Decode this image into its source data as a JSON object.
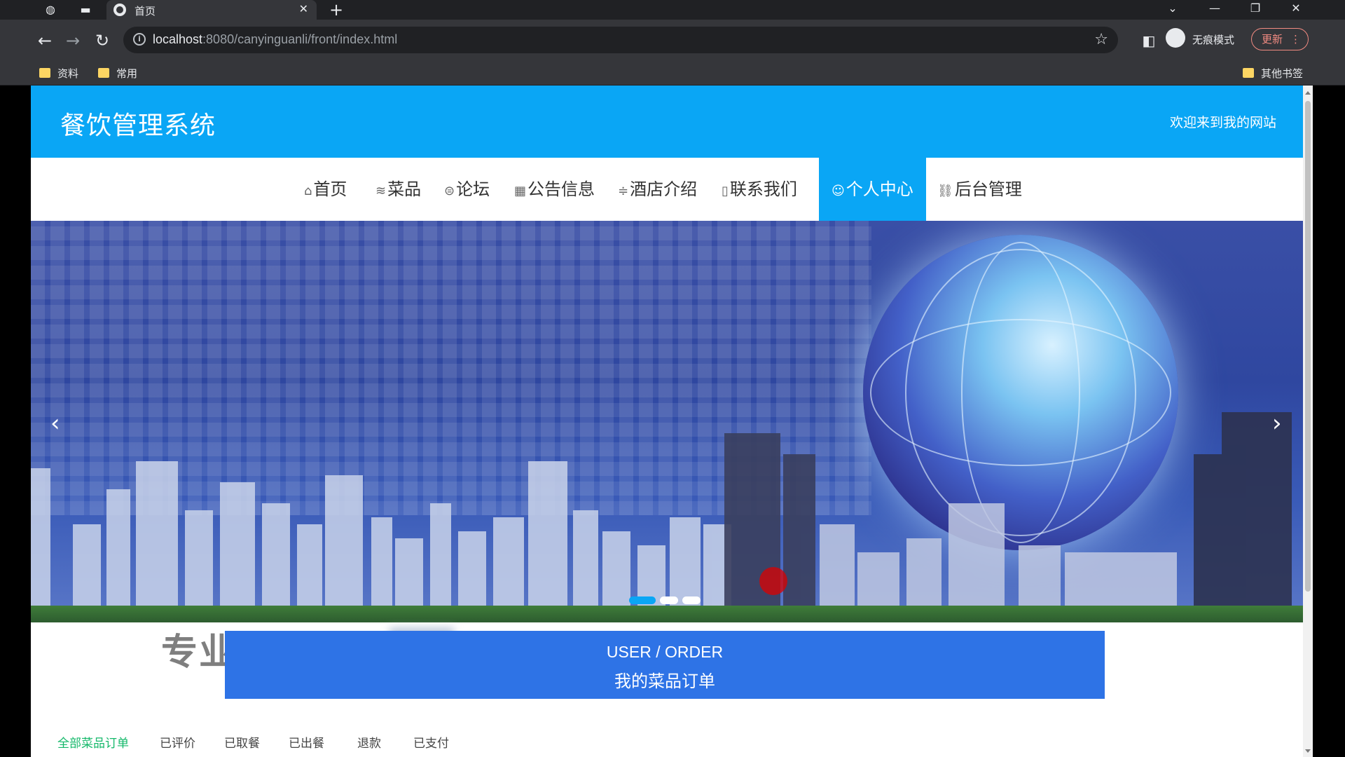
{
  "browser": {
    "tab_title": "首页",
    "url_host": "localhost",
    "url_rest": ":8080/canyinguanli/front/index.html",
    "incognito_label": "无痕模式",
    "update_label": "更新",
    "bookmarks": [
      "资料",
      "常用"
    ],
    "other_bookmarks": "其他书签"
  },
  "site": {
    "title": "餐饮管理系统",
    "welcome": "欢迎来到我的网站",
    "nav": [
      {
        "label": "首页",
        "icon": "home-icon"
      },
      {
        "label": "菜品",
        "icon": "layers-icon"
      },
      {
        "label": "论坛",
        "icon": "forum-icon"
      },
      {
        "label": "公告信息",
        "icon": "grid-icon"
      },
      {
        "label": "酒店介绍",
        "icon": "sliders-icon"
      },
      {
        "label": "联系我们",
        "icon": "contact-icon"
      },
      {
        "label": "个人中心",
        "icon": "user-icon",
        "active": true
      },
      {
        "label": "后台管理",
        "icon": "link-icon"
      }
    ],
    "carousel": {
      "slide_count": 3,
      "active_index": 0
    },
    "watermark": "专业毕业设计",
    "order_banner": {
      "en": "USER / ORDER",
      "cn": "我的菜品订单"
    },
    "order_tabs": [
      {
        "label": "全部菜品订单",
        "active": true
      },
      {
        "label": "已评价"
      },
      {
        "label": "已取餐"
      },
      {
        "label": "已出餐"
      },
      {
        "label": "退款"
      },
      {
        "label": "已支付"
      }
    ]
  },
  "colors": {
    "accent": "#0aa6f5",
    "order_banner": "#2e73e6",
    "active_tab_text": "#14b86a"
  }
}
